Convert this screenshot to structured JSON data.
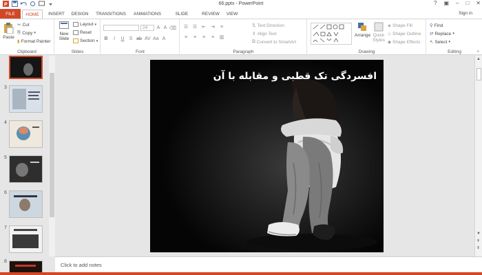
{
  "window": {
    "title": "66.pptx - PowerPoint",
    "sign_in": "Sign in"
  },
  "tabs": [
    {
      "label": "FILE"
    },
    {
      "label": "HOME"
    },
    {
      "label": "INSERT"
    },
    {
      "label": "DESIGN"
    },
    {
      "label": "TRANSITIONS"
    },
    {
      "label": "ANIMATIONS"
    },
    {
      "label": "SLIDE SHOW"
    },
    {
      "label": "REVIEW"
    },
    {
      "label": "VIEW"
    }
  ],
  "ribbon": {
    "clipboard": {
      "label": "Clipboard",
      "paste": "Paste",
      "cut": "Cut",
      "copy": "Copy",
      "format_painter": "Format Painter"
    },
    "slides": {
      "label": "Slides",
      "new_slide": "New",
      "new_slide2": "Slide",
      "layout": "Layout",
      "reset": "Reset",
      "section": "Section"
    },
    "font": {
      "label": "Font",
      "size": "24"
    },
    "paragraph": {
      "label": "Paragraph",
      "text_direction": "Text Direction",
      "align_text": "Align Text",
      "convert_smartart": "Convert to SmartArt"
    },
    "drawing": {
      "label": "Drawing",
      "arrange": "Arrange",
      "quick_styles": "Quick",
      "quick_styles2": "Styles",
      "shape_fill": "Shape Fill",
      "shape_outline": "Shape Outline",
      "shape_effects": "Shape Effects"
    },
    "editing": {
      "label": "Editing",
      "find": "Find",
      "replace": "Replace",
      "select": "Select"
    }
  },
  "thumbnails": [
    {
      "num": ""
    },
    {
      "num": "3"
    },
    {
      "num": "4"
    },
    {
      "num": "5"
    },
    {
      "num": "6"
    },
    {
      "num": "7"
    },
    {
      "num": "8"
    }
  ],
  "slide": {
    "title": "افسردگی تک قطبی و مقابله با آن"
  },
  "notes": {
    "placeholder": "Click to add notes"
  },
  "colors": {
    "accent": "#d24726"
  }
}
